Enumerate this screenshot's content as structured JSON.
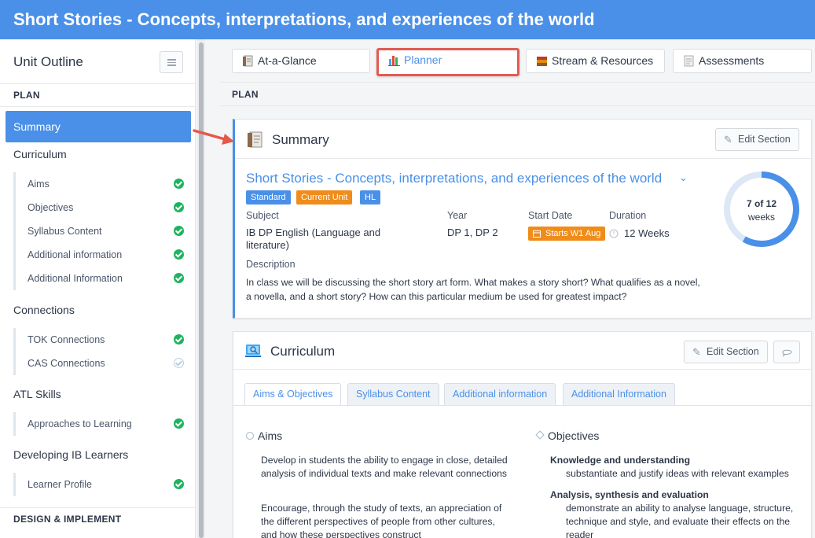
{
  "header": {
    "title": "Short Stories - Concepts, interpretations, and experiences of the world"
  },
  "sidebar": {
    "title": "Unit Outline",
    "section_plan": "PLAN",
    "active_item": "Summary",
    "groups": [
      {
        "label": "Curriculum",
        "items": [
          {
            "label": "Aims",
            "done": true
          },
          {
            "label": "Objectives",
            "done": true
          },
          {
            "label": "Syllabus Content",
            "done": true
          },
          {
            "label": "Additional information",
            "done": true
          },
          {
            "label": "Additional Information",
            "done": true
          }
        ]
      },
      {
        "label": "Connections",
        "items": [
          {
            "label": "TOK Connections",
            "done": true
          },
          {
            "label": "CAS Connections",
            "done": false
          }
        ]
      },
      {
        "label": "ATL Skills",
        "items": [
          {
            "label": "Approaches to Learning",
            "done": true
          }
        ]
      },
      {
        "label": "Developing IB Learners",
        "items": [
          {
            "label": "Learner Profile",
            "done": true
          }
        ]
      }
    ],
    "section_design": "DESIGN & IMPLEMENT"
  },
  "tabs": [
    {
      "label": "At-a-Glance",
      "icon": "document-icon"
    },
    {
      "label": "Planner",
      "icon": "bar-chart-icon"
    },
    {
      "label": "Stream & Resources",
      "icon": "books-icon"
    },
    {
      "label": "Assessments",
      "icon": "clipboard-icon"
    }
  ],
  "plan_label": "PLAN",
  "summary": {
    "section_title": "Summary",
    "edit_label": "Edit Section",
    "unit_title": "Short Stories - Concepts, interpretations, and experiences of the world",
    "badges": [
      "Standard",
      "Current Unit",
      "HL"
    ],
    "subject_label": "Subject",
    "subject_value_line1": "IB DP English (Language and",
    "subject_value_line2": "literature)",
    "year_label": "Year",
    "year_value": "DP 1, DP 2",
    "start_label": "Start Date",
    "start_value": "Starts W1 Aug",
    "duration_label": "Duration",
    "duration_value": "12 Weeks",
    "description_label": "Description",
    "description": "In class we will be discussing the short story art form. What makes a story short? What qualifies as a novel, a novella, and a short story? How can this particular medium be used for greatest impact?",
    "progress_text": "7 of 12",
    "progress_unit": "weeks",
    "progress_done": 7,
    "progress_total": 12
  },
  "curriculum": {
    "section_title": "Curriculum",
    "edit_label": "Edit Section",
    "tabs": [
      "Aims & Objectives",
      "Syllabus Content",
      "Additional information",
      "Additional Information"
    ],
    "aims_heading": "Aims",
    "aims_p1": "Develop in students the ability to engage in close, detailed analysis of individual texts and make relevant connections",
    "aims_p2": "Encourage, through the study of texts, an appreciation of the different perspectives of people from other cultures, and how these perspectives construct",
    "objectives_heading": "Objectives",
    "obj1_title": "Knowledge and understanding",
    "obj1_text": "substantiate and justify ideas with relevant examples",
    "obj2_title": "Analysis, synthesis and evaluation",
    "obj2_text": "demonstrate an ability to analyse language, structure, technique and style, and evaluate their effects on the reader"
  },
  "colors": {
    "brand": "#4a90e8",
    "highlight": "#e25b52",
    "check": "#1fb35f",
    "badge_blue": "#4a90e8",
    "badge_orange": "#f08c1a"
  }
}
